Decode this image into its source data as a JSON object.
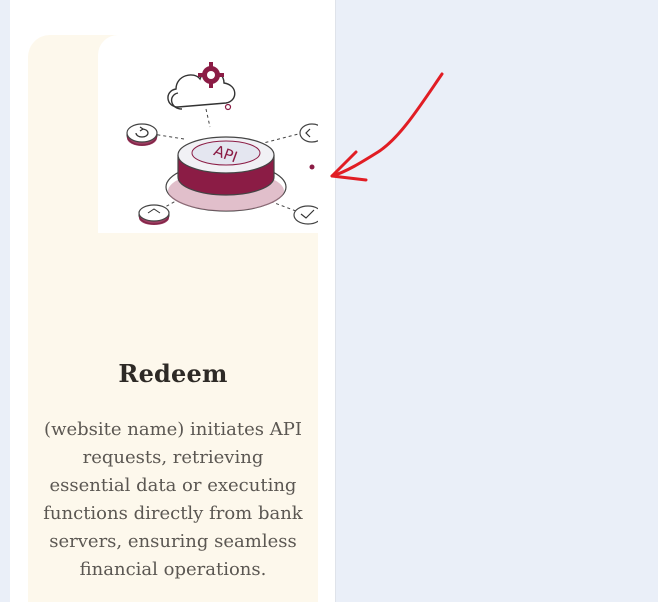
{
  "card": {
    "title": "Redeem",
    "description": "(website name) initiates API requests, retrieving essential data or executing functions directly from bank servers, ensuring seamless financial operations.",
    "illustration": {
      "icon": "api-hub-illustration",
      "badge_text": "API"
    }
  },
  "annotation": {
    "icon": "red-arrow-annotation",
    "color": "#e11d24"
  },
  "colors": {
    "brand": "#8b1c45",
    "card_bg": "#fdf8ec",
    "page_bg": "#eaeff8"
  }
}
